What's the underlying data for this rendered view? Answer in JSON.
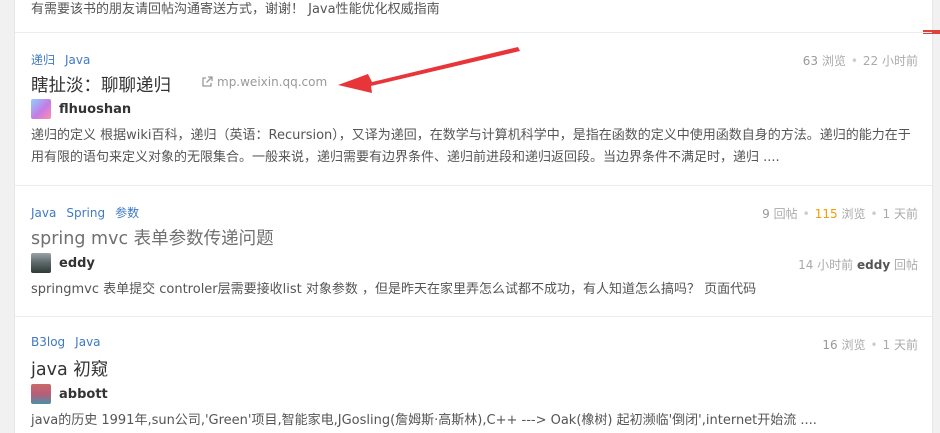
{
  "previous_post": {
    "excerpt": "有需要该书的朋友请回帖沟通寄送方式，谢谢！ Java性能优化权威指南"
  },
  "posts": [
    {
      "tags": [
        "递归",
        "Java"
      ],
      "title": "瞎扯淡：聊聊递归",
      "source": "mp.weixin.qq.com",
      "author": "flhuoshan",
      "views": "63",
      "views_label": "浏览",
      "time": "22 小时前",
      "excerpt": "递归的定义 根据wiki百科，递归（英语：Recursion），又译为递回，在数学与计算机科学中，是指在函数的定义中使用函数自身的方法。递归的能力在于用有限的语句来定义对象的无限集合。一般来说，递归需要有边界条件、递归前进段和递归返回段。当边界条件不满足时，递归 ...."
    },
    {
      "tags": [
        "Java",
        "Spring",
        "参数"
      ],
      "title": "spring mvc 表单参数传递问题",
      "replies": "9",
      "replies_label": "回帖",
      "views": "115",
      "views_label": "浏览",
      "time": "1 天前",
      "author": "eddy",
      "last_reply_time": "14 小时前",
      "last_reply_user": "eddy",
      "last_reply_label": "回帖",
      "excerpt": "springmvc 表单提交 controler层需要接收list 对象参数 ，但是昨天在家里弄怎么试都不成功，有人知道怎么搞吗？ 页面代码"
    },
    {
      "tags": [
        "B3log",
        "Java"
      ],
      "title": "java 初窥",
      "views": "16",
      "views_label": "浏览",
      "time": "1 天前",
      "author": "abbott",
      "excerpt": "java的历史 1991年,sun公司,'Green'项目,智能家电,JGosling(詹姆斯·高斯林),C++ ---> Oak(橡树) 起初濒临'倒闭',internet开始流 ...."
    }
  ],
  "colors": {
    "tag": "#3f7ac1",
    "hot_views": "#f0a000",
    "annotation_arrow": "#e8353a"
  },
  "icons": {
    "external_link": "external-link-icon"
  }
}
